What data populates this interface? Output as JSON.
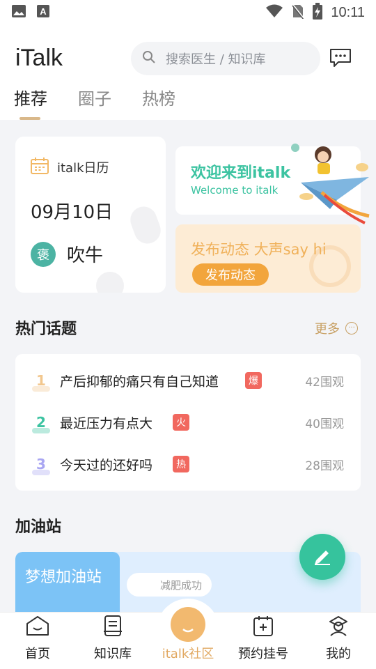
{
  "status_bar": {
    "time": "10:11",
    "icons": [
      "image-icon",
      "text-icon",
      "wifi-icon",
      "no-sim-icon",
      "battery-charging-icon"
    ]
  },
  "header": {
    "title": "iTalk",
    "search_placeholder": "搜索医生 / 知识库",
    "message_icon": "chat-bubble-icon"
  },
  "tabs": [
    {
      "label": "推荐",
      "active": true
    },
    {
      "label": "圈子",
      "active": false
    },
    {
      "label": "热榜",
      "active": false
    }
  ],
  "calendar_card": {
    "label": "italk日历",
    "date": "09月10日",
    "tag": "褒",
    "word": "吹牛"
  },
  "welcome_card": {
    "title": "欢迎来到italk",
    "subtitle": "Welcome to italk"
  },
  "post_card": {
    "title": "发布动态 大声say hi",
    "button": "发布动态"
  },
  "hot_topics": {
    "title": "热门话题",
    "more": "更多",
    "items": [
      {
        "rank": "1",
        "text": "产后抑郁的痛只有自己知道",
        "badge": "爆",
        "count": "42围观",
        "rank_color": "#f2c78e"
      },
      {
        "rank": "2",
        "text": "最近压力有点大",
        "badge": "火",
        "count": "40围观",
        "rank_color": "#3cc3a1"
      },
      {
        "rank": "3",
        "text": "今天过的还好吗",
        "badge": "热",
        "count": "28围观",
        "rank_color": "#a9a6f2"
      }
    ]
  },
  "station": {
    "title": "加油站",
    "banner_name": "梦想加油站",
    "chip": "减肥成功"
  },
  "bottom_nav": [
    {
      "label": "首页",
      "icon": "home-icon",
      "active": false
    },
    {
      "label": "知识库",
      "icon": "book-icon",
      "active": false
    },
    {
      "label": "italk社区",
      "icon": "community-icon",
      "active": true
    },
    {
      "label": "预约挂号",
      "icon": "calendar-plus-icon",
      "active": false
    },
    {
      "label": "我的",
      "icon": "profile-icon",
      "active": false
    }
  ]
}
